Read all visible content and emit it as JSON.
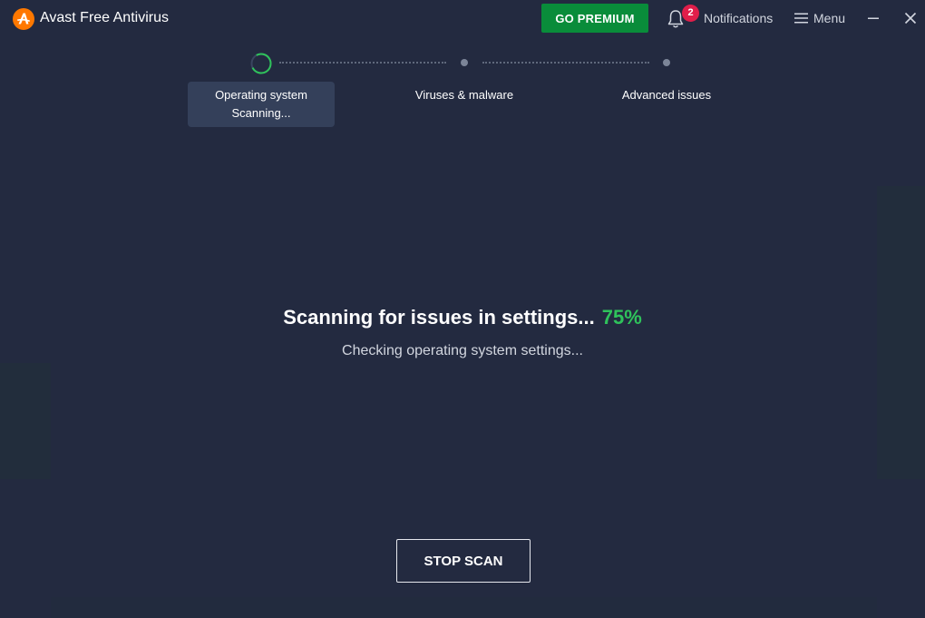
{
  "app": {
    "title": "Avast Free Antivirus",
    "accent_color": "#ff7800"
  },
  "header": {
    "premium_label": "GO PREMIUM",
    "notifications_label": "Notifications",
    "notifications_count": "2",
    "menu_label": "Menu",
    "icons": [
      "avast-logo-icon",
      "bell-icon",
      "hamburger-icon",
      "minimize-icon",
      "close-icon"
    ]
  },
  "stepper": {
    "steps": [
      {
        "label": "Operating system",
        "status": "Scanning...",
        "state": "active"
      },
      {
        "label": "Viruses & malware",
        "state": "pending"
      },
      {
        "label": "Advanced issues",
        "state": "pending"
      }
    ]
  },
  "scan": {
    "headline": "Scanning for issues in settings...",
    "progress_text": "75%",
    "progress": 0.75,
    "detail": "Checking operating system settings...",
    "progress_color": "#2fc25b"
  },
  "actions": {
    "stop_label": "STOP SCAN"
  }
}
